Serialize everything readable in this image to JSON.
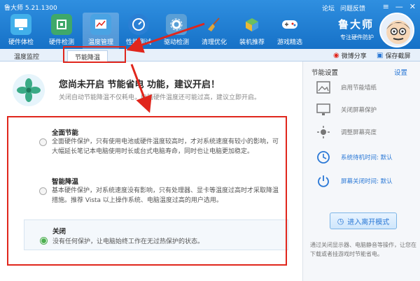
{
  "window": {
    "title": "鲁大师 5.21.1300"
  },
  "toolbar": {
    "items": [
      {
        "label": "硬件体检",
        "icon": "monitor-icon",
        "color": "#42b0ea"
      },
      {
        "label": "硬件检测",
        "icon": "chip-icon",
        "color": "#3fa86a"
      },
      {
        "label": "温度管理",
        "icon": "thermometer-icon",
        "color": "#4aa3e3"
      },
      {
        "label": "性能测试",
        "icon": "speedometer-icon",
        "color": "#2a7fd4"
      },
      {
        "label": "驱动检测",
        "icon": "gear-icon",
        "color": "#5a9fd6"
      },
      {
        "label": "清理优化",
        "icon": "broom-icon",
        "color": "#d9a23a"
      },
      {
        "label": "装机推荐",
        "icon": "cube-icon",
        "color": "#6bbf5f"
      },
      {
        "label": "游戏精选",
        "icon": "gamepad-icon",
        "color": "#ffffff"
      }
    ]
  },
  "top_links": {
    "forum": "论坛",
    "feedback": "问题反馈"
  },
  "window_controls": {
    "menu": "≡",
    "minimize": "—",
    "close": "✕"
  },
  "brand": {
    "name": "鲁大师",
    "slogan": "专注硬件防护"
  },
  "subtabs": {
    "temp_monitor": "温度监控",
    "energy": "节能降温"
  },
  "share": {
    "weibo": "微博分享",
    "screenshot": "保存截屏"
  },
  "main": {
    "headline": "您尚未开启 节能省电 功能，建议开启！",
    "subline": "关闭自动节能降温不仅耗电，电脑硬件温度还可能过高，建议立即开启。",
    "modes": [
      {
        "name": "全面节能",
        "desc": "全面硬件保护，只有使用电池或硬件温度较高时，才对系统速度有较小的影响，可大幅延长笔记本电脑使用时长或台式电脑寿命，同时也让电脑更加稳定。",
        "selected": false
      },
      {
        "name": "智能降温",
        "desc": "基本硬件保护，对系统速度没有影响，只有处理器、显卡等温度过高时才采取降温措施。推荐 Vista 以上操作系统、电脑温度过高的用户选用。",
        "selected": false
      },
      {
        "name": "关闭",
        "desc": "没有任何保护，让电脑始终工作在无过热保护的状态。",
        "selected": true
      }
    ]
  },
  "side": {
    "title": "节能设置",
    "settings_link": "设置",
    "rows": [
      {
        "label": "启用节能墙纸",
        "icon": "wallpaper-icon",
        "blue": false
      },
      {
        "label": "关闭屏幕保护",
        "icon": "screen-icon",
        "blue": false
      },
      {
        "label": "调整屏幕亮度",
        "icon": "brightness-icon",
        "blue": false
      },
      {
        "label": "系统待机时间: 默认",
        "icon": "clock-icon",
        "blue": true
      },
      {
        "label": "屏幕关闭时间: 默认",
        "icon": "power-icon",
        "blue": true
      }
    ],
    "enter_button": "进入离开模式",
    "note": "通过关闭显示器、电脑静音等操作，让您在下载或者挂游戏时节能省电。"
  },
  "colors": {
    "accent": "#1a78d2",
    "annotation": "#e0261c",
    "selected": "#4caf50"
  }
}
